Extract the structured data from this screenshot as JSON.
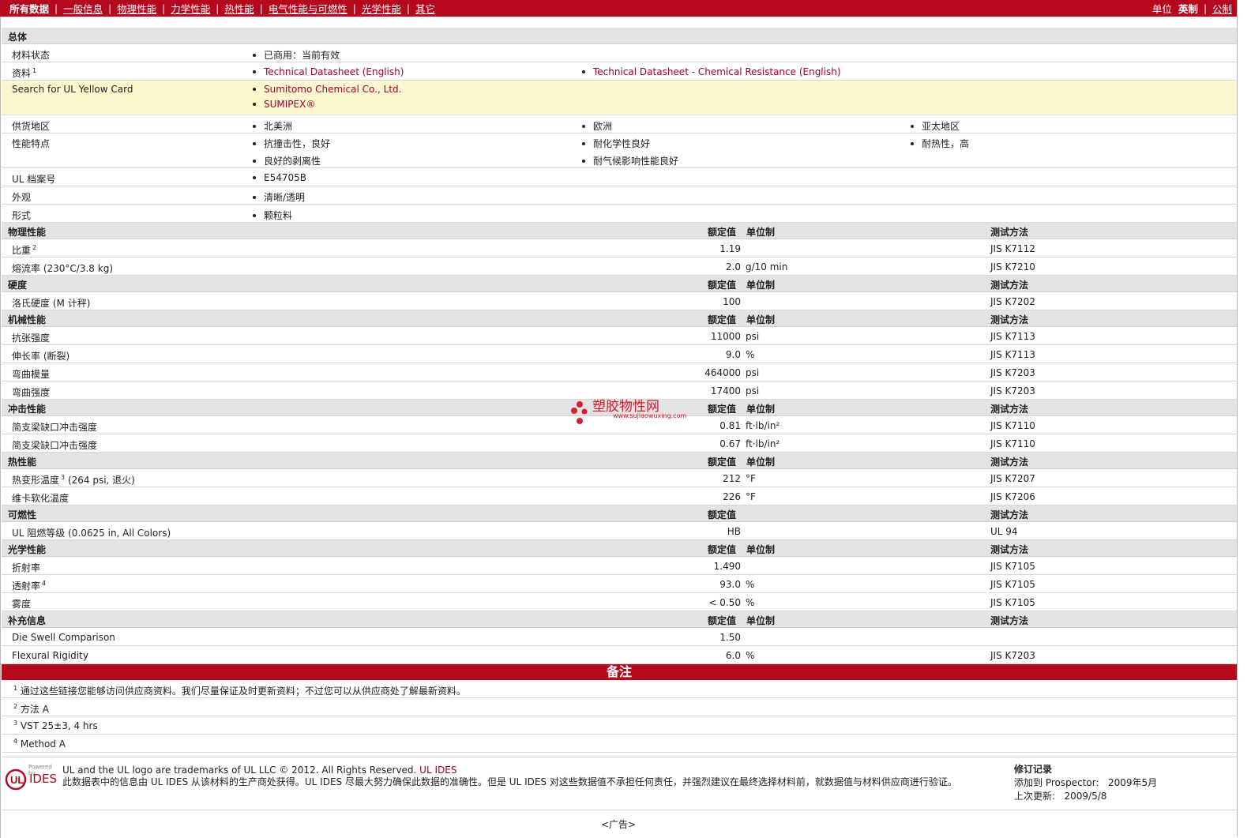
{
  "nav": {
    "items": [
      "所有数据",
      "一般信息",
      "物理性能",
      "力学性能",
      "热性能",
      "电气性能与可燃性",
      "光学性能",
      "其它"
    ],
    "unit_label": "单位",
    "unit_imperial": "英制",
    "unit_metric": "公制"
  },
  "general": {
    "title": "总体",
    "status_label": "材料状态",
    "status_value": "已商用：当前有效",
    "docs_label": "资料",
    "docs_sup": "1",
    "doc1": "Technical Datasheet (English)",
    "doc2": "Technical Datasheet - Chemical Resistance (English)",
    "ul_card_label": "Search for UL Yellow Card",
    "ul_card_1": "Sumitomo Chemical Co., Ltd.",
    "ul_card_2": "SUMIPEX®",
    "regions_label": "供货地区",
    "regions": [
      "北美洲",
      "欧洲",
      "亚太地区"
    ],
    "features_label": "性能特点",
    "features": [
      "抗撞击性，良好",
      "耐化学性良好",
      "耐热性，高",
      "良好的剥离性",
      "耐气候影响性能良好"
    ],
    "ul_file_label": "UL 档案号",
    "ul_file_value": "E54705B",
    "appearance_label": "外观",
    "appearance_value": "清晰/透明",
    "form_label": "形式",
    "form_value": "颗粒料"
  },
  "headers": {
    "value": "额定值",
    "unit": "单位制",
    "method": "测试方法"
  },
  "physical": {
    "title": "物理性能",
    "rows": [
      {
        "label": "比重",
        "sup": "2",
        "cond": "",
        "value": "1.19",
        "unit": "",
        "method": "JIS K7112"
      },
      {
        "label": "熔流率",
        "sup": "",
        "cond": "(230°C/3.8 kg)",
        "value": "2.0",
        "unit": "g/10 min",
        "method": "JIS K7210"
      }
    ]
  },
  "hardness": {
    "title": "硬度",
    "rows": [
      {
        "label": "洛氏硬度",
        "sup": "",
        "cond": "(M 计秤)",
        "value": "100",
        "unit": "",
        "method": "JIS K7202"
      }
    ]
  },
  "mechanical": {
    "title": "机械性能",
    "rows": [
      {
        "label": "抗张强度",
        "sup": "",
        "cond": "",
        "value": "11000",
        "unit": "psi",
        "method": "JIS K7113"
      },
      {
        "label": "伸长率",
        "sup": "",
        "cond": "(断裂)",
        "value": "9.0",
        "unit": "%",
        "method": "JIS K7113"
      },
      {
        "label": "弯曲模量",
        "sup": "",
        "cond": "",
        "value": "464000",
        "unit": "psi",
        "method": "JIS K7203"
      },
      {
        "label": "弯曲强度",
        "sup": "",
        "cond": "",
        "value": "17400",
        "unit": "psi",
        "method": "JIS K7203"
      }
    ]
  },
  "impact": {
    "title": "冲击性能",
    "rows": [
      {
        "label": "简支梁缺口冲击强度",
        "sup": "",
        "cond": "",
        "value": "0.81",
        "unit": "ft·lb/in²",
        "method": "JIS K7110"
      },
      {
        "label": "简支梁缺口冲击强度",
        "sup": "",
        "cond": "",
        "value": "0.67",
        "unit": "ft·lb/in²",
        "method": "JIS K7110"
      }
    ]
  },
  "thermal": {
    "title": "热性能",
    "rows": [
      {
        "label": "热变形温度",
        "sup": "3",
        "cond": "(264 psi, 退火)",
        "value": "212",
        "unit": "°F",
        "method": "JIS K7207"
      },
      {
        "label": "维卡软化温度",
        "sup": "",
        "cond": "",
        "value": "226",
        "unit": "°F",
        "method": "JIS K7206"
      }
    ]
  },
  "flammability": {
    "title": "可燃性",
    "rows": [
      {
        "label": "UL 阻燃等级",
        "sup": "",
        "cond": "(0.0625 in, All Colors)",
        "value": "HB",
        "unit": "",
        "method": "UL 94"
      }
    ]
  },
  "optical": {
    "title": "光学性能",
    "rows": [
      {
        "label": "折射率",
        "sup": "",
        "cond": "",
        "value": "1.490",
        "unit": "",
        "method": "JIS K7105"
      },
      {
        "label": "透射率",
        "sup": "4",
        "cond": "",
        "value": "93.0",
        "unit": "%",
        "method": "JIS K7105"
      },
      {
        "label": "雾度",
        "sup": "",
        "cond": "",
        "value": "< 0.50",
        "unit": "%",
        "method": "JIS K7105"
      }
    ]
  },
  "additional": {
    "title": "补充信息",
    "rows": [
      {
        "label": "Die Swell Comparison",
        "value": "1.50",
        "unit": "",
        "method": ""
      },
      {
        "label": "Flexural Rigidity",
        "value": "6.0",
        "unit": "%",
        "method": "JIS K7203"
      }
    ]
  },
  "remarks": {
    "title": "备注",
    "notes": [
      {
        "num": "1",
        "text": "通过这些链接您能够访问供应商资料。我们尽量保证及时更新资料；不过您可以从供应商处了解最新资料。"
      },
      {
        "num": "2",
        "text": "方法 A"
      },
      {
        "num": "3",
        "text": "VST 25±3, 4 hrs"
      },
      {
        "num": "4",
        "text": "Method A"
      }
    ]
  },
  "watermark": {
    "text": "塑胶物性网",
    "url": "www.sujiaowuxing.com"
  },
  "footer": {
    "powered": "Powered by",
    "brand": "IDES",
    "line1_a": "UL and the UL logo are trademarks of UL LLC © 2012. All Rights Reserved. ",
    "line1_link": "UL IDES",
    "line2": "此数据表中的信息由 UL IDES 从该材料的生产商处获得。UL IDES 尽最大努力确保此数据的准确性。但是 UL IDES 对这些数据值不承担任何责任，并强烈建议在最终选择材料前，就数据值与材料供应商进行验证。",
    "rev_title": "修订记录",
    "rev_added_label": "添加到 Prospector:",
    "rev_added_value": "2009年5月",
    "rev_updated_label": "上次更新:",
    "rev_updated_value": "2009/5/8",
    "ad": "<广告>"
  }
}
